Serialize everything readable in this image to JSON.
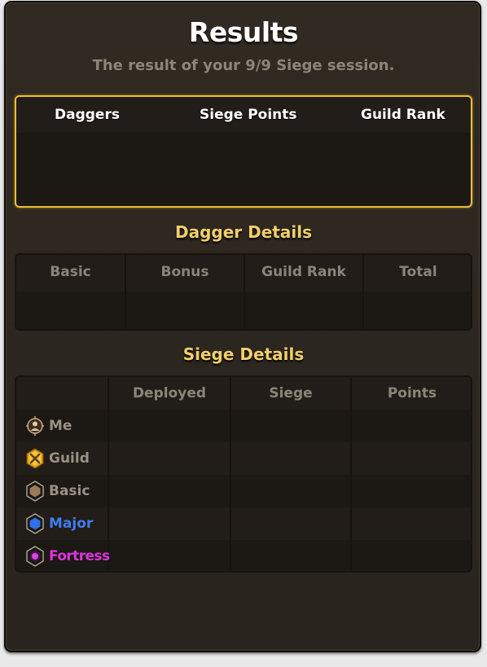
{
  "header": {
    "title": "Results",
    "subtitle": "The result of your 9/9 Siege session."
  },
  "summary": {
    "columns": [
      "Daggers",
      "Siege Points",
      "Guild Rank"
    ]
  },
  "dagger_details": {
    "title": "Dagger Details",
    "columns": [
      "Basic",
      "Bonus",
      "Guild Rank",
      "Total"
    ]
  },
  "siege_details": {
    "title": "Siege Details",
    "columns": [
      "Deployed",
      "Siege",
      "Points"
    ],
    "rows": [
      {
        "label": "Me",
        "icon": "player-icon",
        "color": "#9a9186"
      },
      {
        "label": "Guild",
        "icon": "guild-crossed-swords-icon",
        "color": "#9a9186"
      },
      {
        "label": "Basic",
        "icon": "basic-hexagon-icon",
        "color": "#9a9186"
      },
      {
        "label": "Major",
        "icon": "major-hexagon-icon",
        "color": "#3f7df0"
      },
      {
        "label": "Fortress",
        "icon": "fortress-hexagon-icon",
        "color": "#dd34dd"
      }
    ]
  },
  "colors": {
    "summary_border": "#e8c130",
    "section_title": "#f2cf6a",
    "header_text": "#8d8479"
  }
}
